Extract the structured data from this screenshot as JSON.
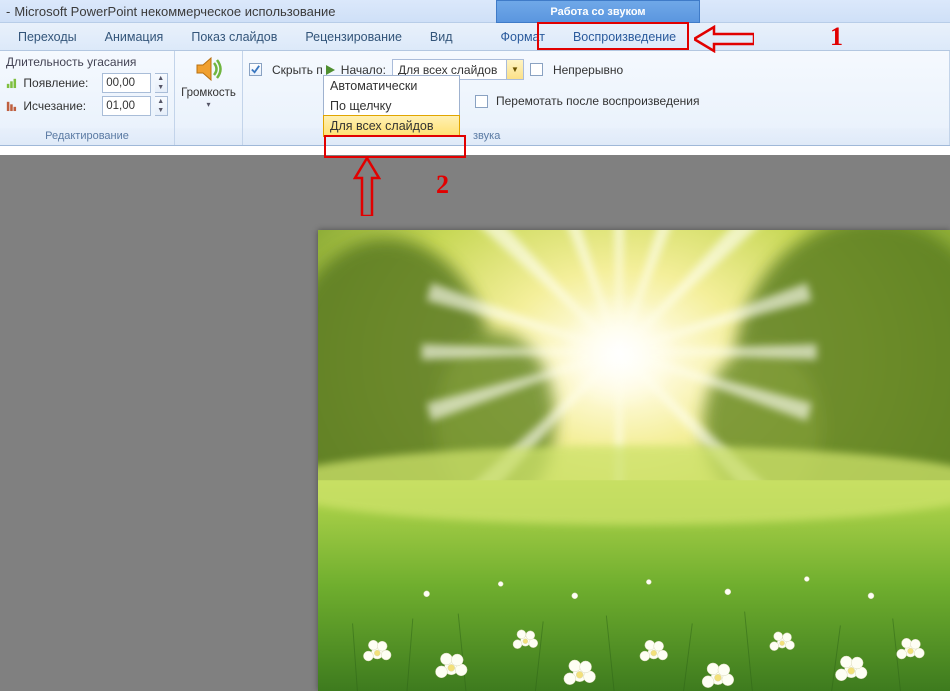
{
  "title": {
    "prefix": "-  ",
    "app": "Microsoft PowerPoint некоммерческое использование"
  },
  "context_tab_title": "Работа со звуком",
  "tabs": {
    "transitions": "Переходы",
    "animation": "Анимация",
    "slideshow": "Показ слайдов",
    "review": "Рецензирование",
    "view": "Вид",
    "format": "Формат",
    "playback": "Воспроизведение"
  },
  "group1": {
    "title": "Длительность угасания",
    "appear_label": "Появление:",
    "appear_value": "00,00",
    "fade_label": "Исчезание:",
    "fade_value": "01,00",
    "name": "Редактирование"
  },
  "group2": {
    "label": "Громкость",
    "dropdown_marker": "▾"
  },
  "group3": {
    "hide_label": "Скрыть п",
    "start_label": "Начало:",
    "start_value": "Для всех слайдов",
    "loop_label": "Непрерывно",
    "rewind_label": "Перемотать после воспроизведения",
    "name_fragment": "звука",
    "dropdown": {
      "auto": "Автоматически",
      "click": "По щелчку",
      "all": "Для всех слайдов"
    }
  },
  "annotations": {
    "n1": "1",
    "n2": "2"
  }
}
